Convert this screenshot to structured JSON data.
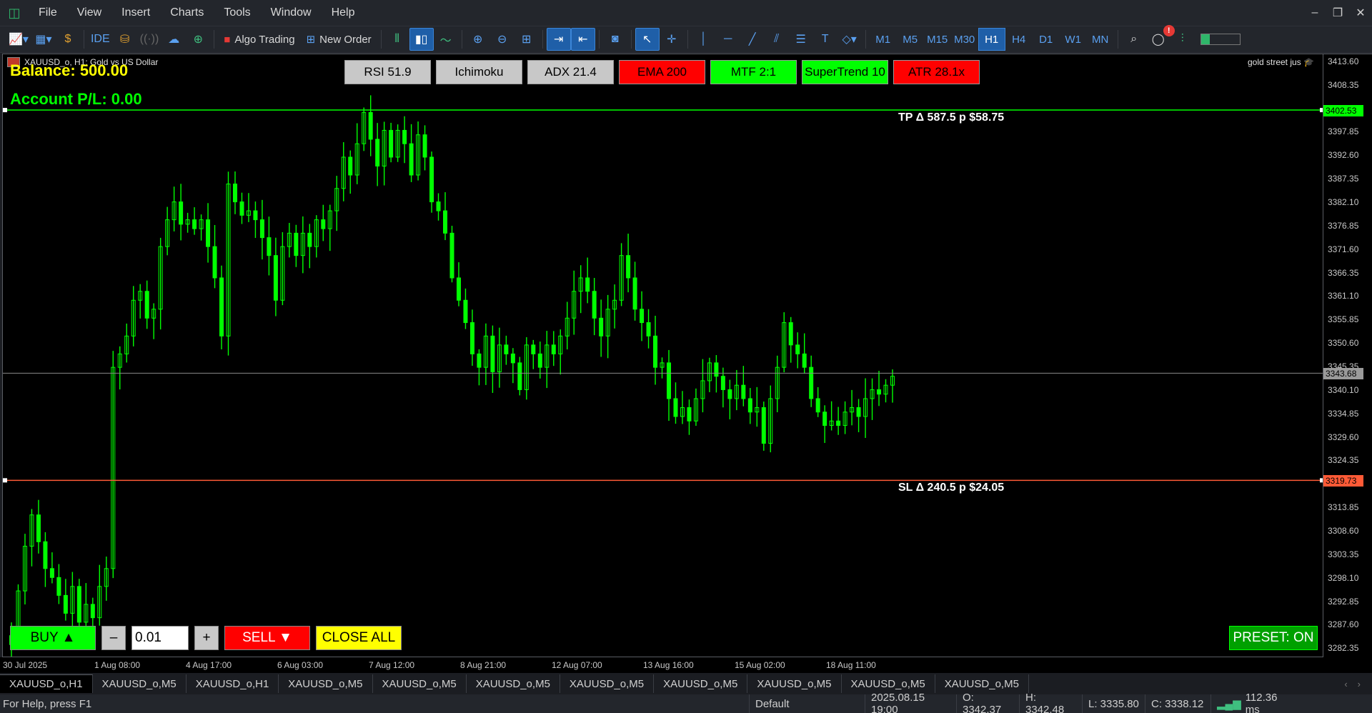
{
  "menu": {
    "items": [
      "File",
      "View",
      "Insert",
      "Charts",
      "Tools",
      "Window",
      "Help"
    ],
    "window_controls": [
      "–",
      "❐",
      "✕"
    ]
  },
  "toolbar": {
    "ide_label": "IDE",
    "algo_trading_label": "Algo Trading",
    "new_order_label": "New Order",
    "timeframes": [
      "M1",
      "M5",
      "M15",
      "M30",
      "H1",
      "H4",
      "D1",
      "W1",
      "MN"
    ],
    "active_timeframe": "H1",
    "notification_badge": "!",
    "connection_level": 0.22
  },
  "chart": {
    "symbol_caption": "XAUUSD_o, H1:  Gold vs US Dollar",
    "right_caption": "gold street jus",
    "balance": "Balance: 500.00",
    "account_pl": "Account P/L: 0.00",
    "indicators": [
      {
        "label": "RSI 51.9",
        "color": "grey"
      },
      {
        "label": "Ichimoku",
        "color": "grey"
      },
      {
        "label": "ADX 21.4",
        "color": "grey"
      },
      {
        "label": "EMA 200",
        "color": "red"
      },
      {
        "label": "MTF 2:1",
        "color": "green"
      },
      {
        "label": "SuperTrend 10",
        "color": "green"
      },
      {
        "label": "ATR 28.1x",
        "color": "red"
      }
    ],
    "tp_label": "TP   Δ 587.5 p   $58.75",
    "sl_label": "SL   Δ 240.5 p   $24.05",
    "colors": {
      "tp": "#00ff00",
      "sl": "#ff5a36",
      "candle": "#00ff00",
      "current": "#8a8a8a"
    }
  },
  "chart_data": {
    "type": "line",
    "ylim": [
      3280.0,
      3415.0
    ],
    "price_ticks": [
      "3413.60",
      "3408.35",
      "3402.53",
      "3397.85",
      "3392.60",
      "3387.35",
      "3382.10",
      "3376.85",
      "3371.60",
      "3366.35",
      "3361.10",
      "3355.85",
      "3350.60",
      "3345.35",
      "3343.68",
      "3340.10",
      "3334.85",
      "3329.60",
      "3324.35",
      "3319.73",
      "3313.85",
      "3308.60",
      "3303.35",
      "3298.10",
      "3292.85",
      "3287.60",
      "3282.35"
    ],
    "tp_price": 3402.53,
    "sl_price": 3319.73,
    "current_price": 3343.68,
    "time_labels": [
      "30 Jul 2025",
      "1 Aug 08:00",
      "4 Aug 17:00",
      "6 Aug 03:00",
      "7 Aug 12:00",
      "8 Aug 21:00",
      "12 Aug 07:00",
      "13 Aug 16:00",
      "15 Aug 02:00",
      "18 Aug 11:00"
    ],
    "closes": [
      3285,
      3295,
      3305,
      3312,
      3306,
      3300,
      3298,
      3294,
      3290,
      3296,
      3288,
      3292,
      3289,
      3296,
      3300,
      3345,
      3348,
      3352,
      3360,
      3362,
      3356,
      3358,
      3372,
      3378,
      3382,
      3377,
      3378,
      3376,
      3378,
      3372,
      3365,
      3352,
      3386,
      3382,
      3379,
      3380,
      3378,
      3374,
      3370,
      3360,
      3372,
      3375,
      3370,
      3375,
      3372,
      3378,
      3376,
      3380,
      3385,
      3392,
      3388,
      3395,
      3402,
      3396,
      3390,
      3398,
      3392,
      3398,
      3395,
      3388,
      3397,
      3392,
      3382,
      3380,
      3375,
      3365,
      3360,
      3355,
      3348,
      3345,
      3352,
      3344,
      3350,
      3348,
      3346,
      3340,
      3350,
      3348,
      3345,
      3350,
      3348,
      3352,
      3356,
      3362,
      3365,
      3362,
      3356,
      3352,
      3358,
      3360,
      3370,
      3365,
      3358,
      3355,
      3352,
      3345,
      3346,
      3338,
      3334,
      3336,
      3333,
      3338,
      3342,
      3346,
      3343,
      3340,
      3338,
      3341,
      3338,
      3335,
      3336,
      3328,
      3338,
      3345,
      3355,
      3350,
      3348,
      3345,
      3338,
      3335,
      3332,
      3333,
      3332,
      3335,
      3336,
      3334,
      3338,
      3340,
      3339,
      3341,
      3343
    ]
  },
  "trade_panel": {
    "buy_label": "BUY ▲",
    "minus_label": "–",
    "lot_value": "0.01",
    "plus_label": "+",
    "sell_label": "SELL ▼",
    "close_all_label": "CLOSE ALL",
    "preset_label": "PRESET: ON"
  },
  "tabs": [
    "XAUUSD_o,H1",
    "XAUUSD_o,M5",
    "XAUUSD_o,H1",
    "XAUUSD_o,M5",
    "XAUUSD_o,M5",
    "XAUUSD_o,M5",
    "XAUUSD_o,M5",
    "XAUUSD_o,M5",
    "XAUUSD_o,M5",
    "XAUUSD_o,M5",
    "XAUUSD_o,M5"
  ],
  "status": {
    "help": "For Help, press F1",
    "profile": "Default",
    "datetime": "2025.08.15 19:00",
    "open": "O: 3342.37",
    "high": "H: 3342.48",
    "low": "L: 3335.80",
    "close": "C: 3338.12",
    "ping": "112.36 ms"
  }
}
